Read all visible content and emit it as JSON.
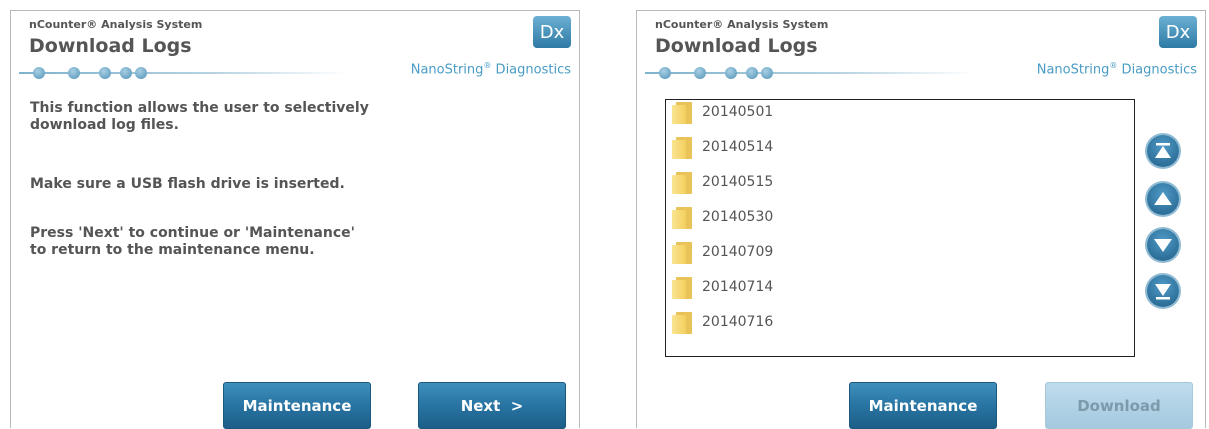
{
  "left_panel": {
    "system_name": "nCounter® Analysis System",
    "title": "Download Logs",
    "dx_badge": "Dx",
    "brand": "NanoString",
    "brand_reg": "®",
    "brand_suffix": " Diagnostics",
    "message_1a": "This function allows the user to selectively",
    "message_1b": "download log files.",
    "message_2": "Make sure a USB flash drive is inserted.",
    "message_3a": "Press 'Next' to continue or 'Maintenance'",
    "message_3b": "to return to the maintenance menu.",
    "maintenance_label": "Maintenance",
    "next_label": "Next  >"
  },
  "right_panel": {
    "system_name": "nCounter® Analysis System",
    "title": "Download Logs",
    "dx_badge": "Dx",
    "brand": "NanoString",
    "brand_reg": "®",
    "brand_suffix": " Diagnostics",
    "folders": [
      "20140501",
      "20140514",
      "20140515",
      "20140530",
      "20140709",
      "20140714",
      "20140716"
    ],
    "maintenance_label": "Maintenance",
    "download_label": "Download",
    "download_enabled": false,
    "nav_icons": [
      "scroll-top-icon",
      "scroll-up-icon",
      "scroll-down-icon",
      "scroll-bottom-icon"
    ]
  },
  "colors": {
    "accent": "#2874a2",
    "brand_text": "#4a9cc4",
    "folder": "#f3cf5e"
  }
}
